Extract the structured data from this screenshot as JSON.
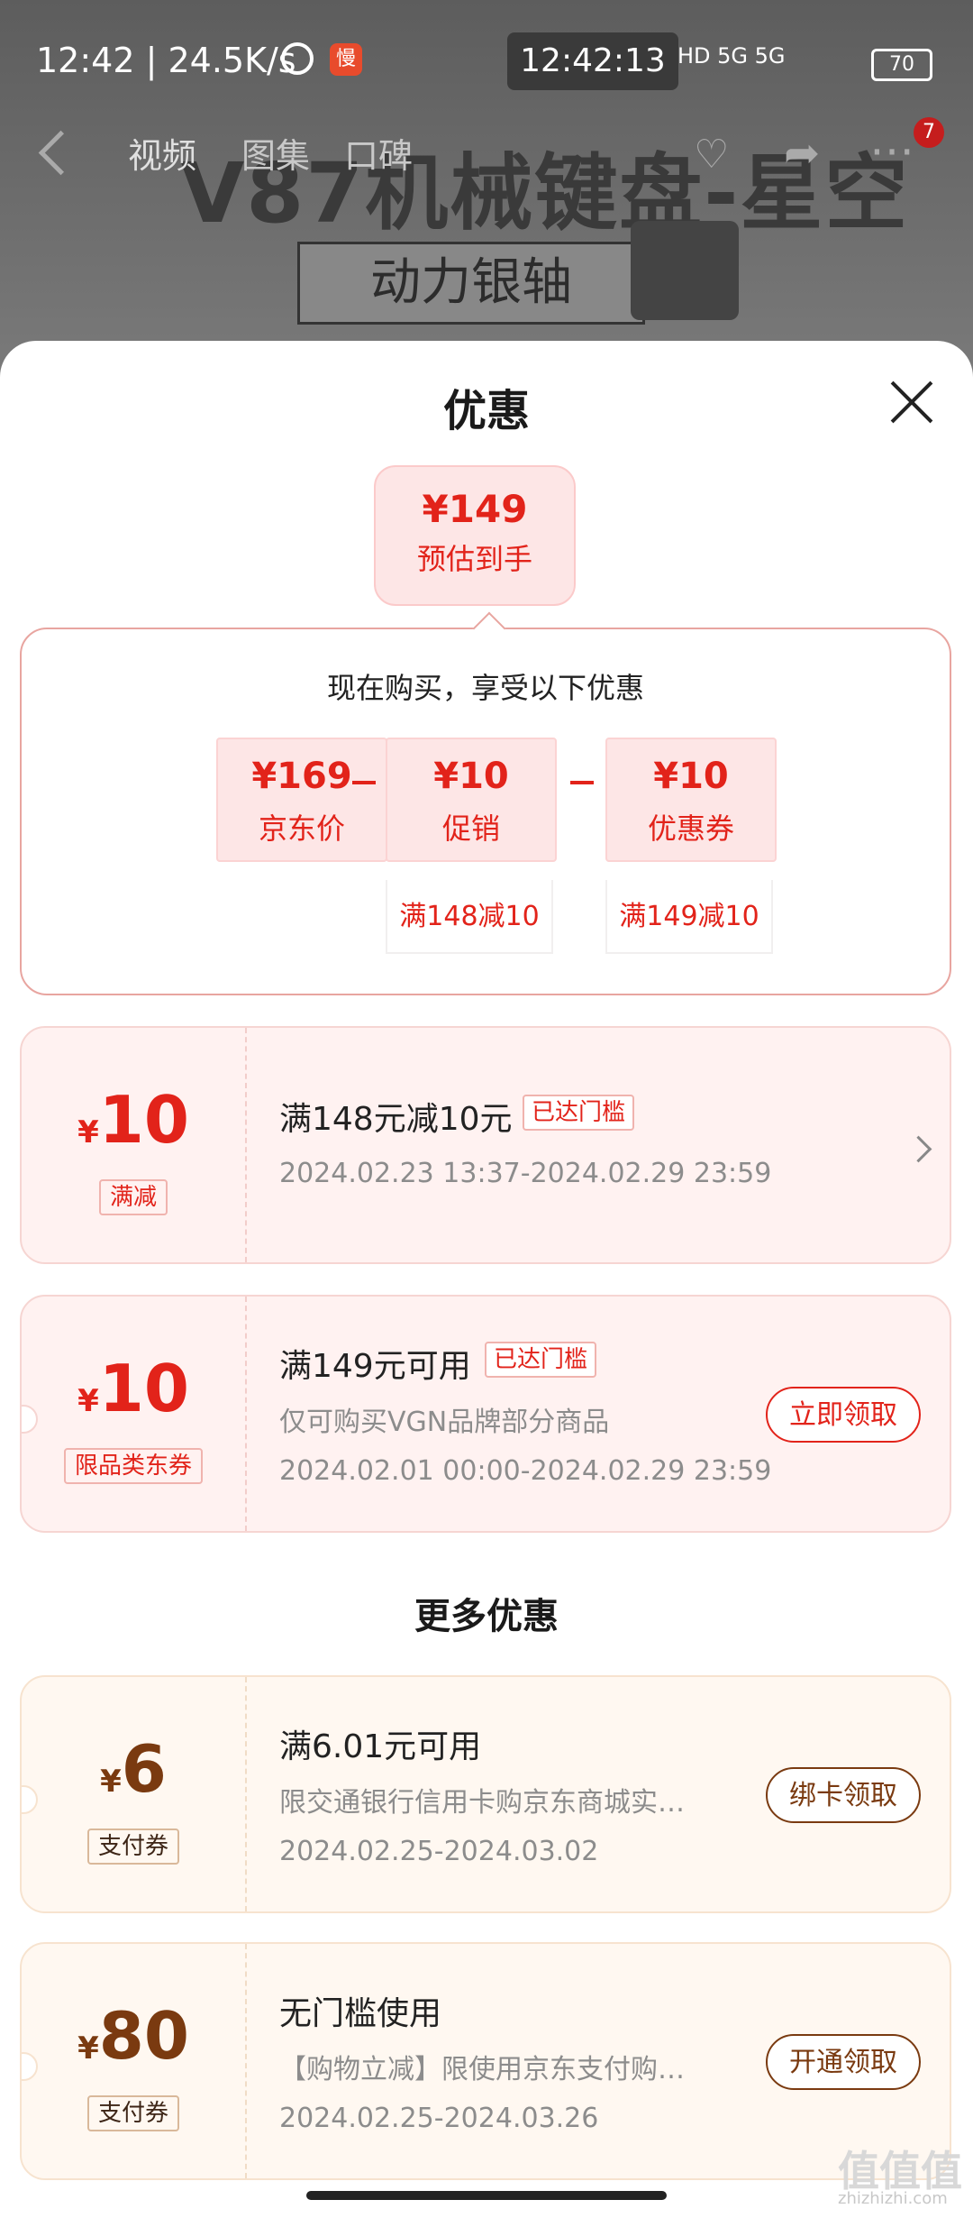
{
  "status_bar": {
    "left": "12:42 | 24.5K/s",
    "app_icon": "慢",
    "center_time": "12:42:13",
    "network": "HD 5G 5G",
    "battery": "70"
  },
  "background_page": {
    "product_title": "V87机械键盘-星空",
    "product_badge": "动力银轴",
    "tabs": [
      "视频",
      "图集",
      "口碑"
    ],
    "more_badge": "7"
  },
  "sheet": {
    "title": "优惠",
    "estimate": {
      "price": "¥149",
      "label": "预估到手"
    },
    "calc": {
      "heading": "现在购买，享受以下优惠",
      "items": [
        {
          "amount": "¥169",
          "label": "京东价",
          "note": ""
        },
        {
          "amount": "¥10",
          "label": "促销",
          "note": "满148减10"
        },
        {
          "amount": "¥10",
          "label": "优惠券",
          "note": "满149减10"
        }
      ]
    },
    "coupons": [
      {
        "yen": "¥",
        "amount": "10",
        "tag": "满减",
        "title": "满148元减10元",
        "badge": "已达门槛",
        "desc": "",
        "date": "2024.02.23 13:37-2024.02.29 23:59",
        "button": ""
      },
      {
        "yen": "¥",
        "amount": "10",
        "tag": "限品类东券",
        "title": "满149元可用",
        "badge": "已达门槛",
        "desc": "仅可购买VGN品牌部分商品",
        "date": "2024.02.01 00:00-2024.02.29 23:59",
        "button": "立即领取"
      }
    ],
    "more_title": "更多优惠",
    "pay_coupons": [
      {
        "yen": "¥",
        "amount": "6",
        "tag": "支付券",
        "title": "满6.01元可用",
        "desc": "限交通银行信用卡购京东商城实…",
        "date": "2024.02.25-2024.03.02",
        "button": "绑卡领取"
      },
      {
        "yen": "¥",
        "amount": "80",
        "tag": "支付券",
        "title": "无门槛使用",
        "desc": "【购物立减】限使用京东支付购…",
        "date": "2024.02.25-2024.03.26",
        "button": "开通领取"
      }
    ]
  },
  "watermark": {
    "main": "值值值",
    "sub": "zhizhizhi.com"
  },
  "colors": {
    "accent": "#e2231a",
    "pay_brown": "#7a3a10",
    "coupon_bg": "#fff2f1"
  }
}
